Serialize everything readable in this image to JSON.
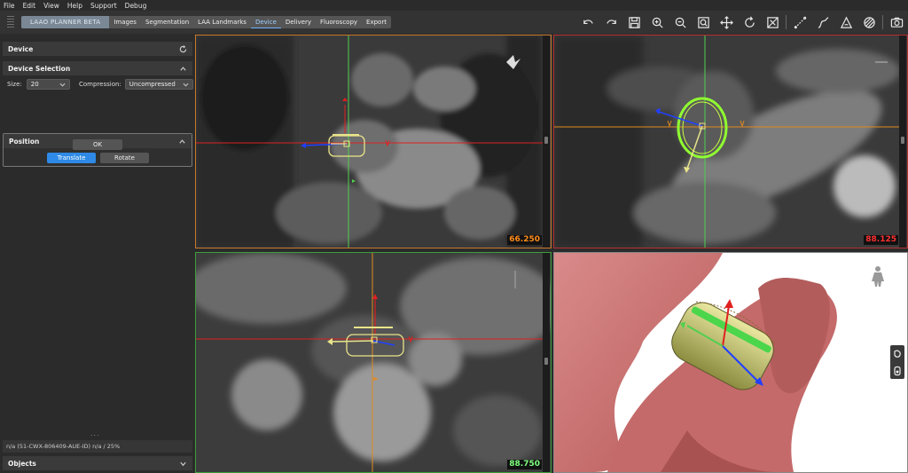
{
  "menu": [
    "File",
    "Edit",
    "View",
    "Help",
    "Support",
    "Debug"
  ],
  "tabs": {
    "brand": "LAAO PLANNER BETA",
    "items": [
      "Images",
      "Segmentation",
      "LAA Landmarks",
      "Device",
      "Delivery",
      "Fluoroscopy",
      "Export"
    ],
    "active": "Device"
  },
  "tools": [
    "undo-icon",
    "redo-icon",
    "save-icon",
    "zoom-in-icon",
    "zoom-out-icon",
    "zoom-fit-icon",
    "pan-icon",
    "rotate-icon",
    "reset-view-icon",
    "ruler-icon",
    "curve-icon",
    "angle-icon",
    "opacity-icon",
    "screenshot-icon"
  ],
  "panel": {
    "device_title": "Device",
    "device_selection_title": "Device Selection",
    "size_label": "Size:",
    "size_value": "20",
    "compression_label": "Compression:",
    "compression_value": "Uncompressed",
    "position_title": "Position",
    "translate_label": "Translate",
    "rotate_label": "Rotate",
    "ok_label": "OK",
    "status_text": "n/a (51-CWX-806409-AUE-ID) n/a / 25%",
    "objects_title": "Objects",
    "dots": "..."
  },
  "viewports": {
    "axial": {
      "value": "66.250",
      "color": "#ff8c1a",
      "border": "#c8792c"
    },
    "coronal": {
      "value": "88.125",
      "color": "#ff3030",
      "border": "#b83030"
    },
    "sagittal": {
      "value": "88.750",
      "color": "#7dff7d",
      "border": "#3b9e3b"
    }
  },
  "colors": {
    "accent": "#2e8ae6",
    "device": "#e9e48a",
    "crosshair_red": "#e02020",
    "crosshair_green": "#50d050",
    "crosshair_orange": "#e08a20"
  }
}
